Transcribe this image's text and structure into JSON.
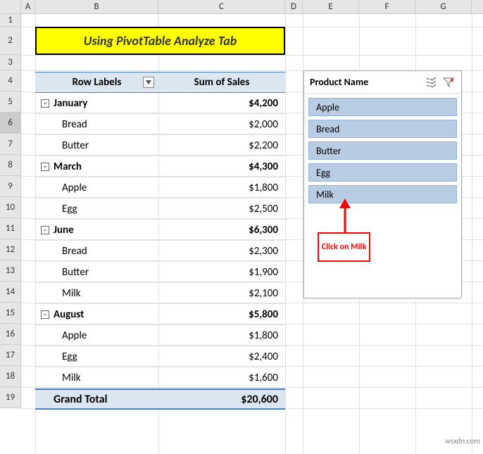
{
  "columns": [
    "A",
    "B",
    "C",
    "D",
    "E",
    "F",
    "G"
  ],
  "rows": [
    1,
    2,
    3,
    4,
    5,
    6,
    7,
    8,
    9,
    10,
    11,
    12,
    13,
    14,
    15,
    16,
    17,
    18,
    19
  ],
  "title": "Using PivotTable Analyze Tab",
  "pivot": {
    "row_labels_header": "Row Labels",
    "values_header": "Sum of Sales",
    "groups": [
      {
        "month": "January",
        "subtotal": "$4,200",
        "items": [
          {
            "name": "Bread",
            "value": "$2,000"
          },
          {
            "name": "Butter",
            "value": "$2,200"
          }
        ]
      },
      {
        "month": "March",
        "subtotal": "$4,300",
        "items": [
          {
            "name": "Apple",
            "value": "$1,800"
          },
          {
            "name": "Egg",
            "value": "$2,500"
          }
        ]
      },
      {
        "month": "June",
        "subtotal": "$6,300",
        "items": [
          {
            "name": "Bread",
            "value": "$2,300"
          },
          {
            "name": "Butter",
            "value": "$1,900"
          },
          {
            "name": "Milk",
            "value": "$2,100"
          }
        ]
      },
      {
        "month": "August",
        "subtotal": "$5,800",
        "items": [
          {
            "name": "Apple",
            "value": "$1,800"
          },
          {
            "name": "Egg",
            "value": "$2,400"
          },
          {
            "name": "Milk",
            "value": "$1,600"
          }
        ]
      }
    ],
    "grand_total_label": "Grand Total",
    "grand_total_value": "$20,600"
  },
  "slicer": {
    "title": "Product Name",
    "items": [
      "Apple",
      "Bread",
      "Butter",
      "Egg",
      "Milk"
    ]
  },
  "annotation": "Click on Milk",
  "watermark": "wsxdn.com"
}
